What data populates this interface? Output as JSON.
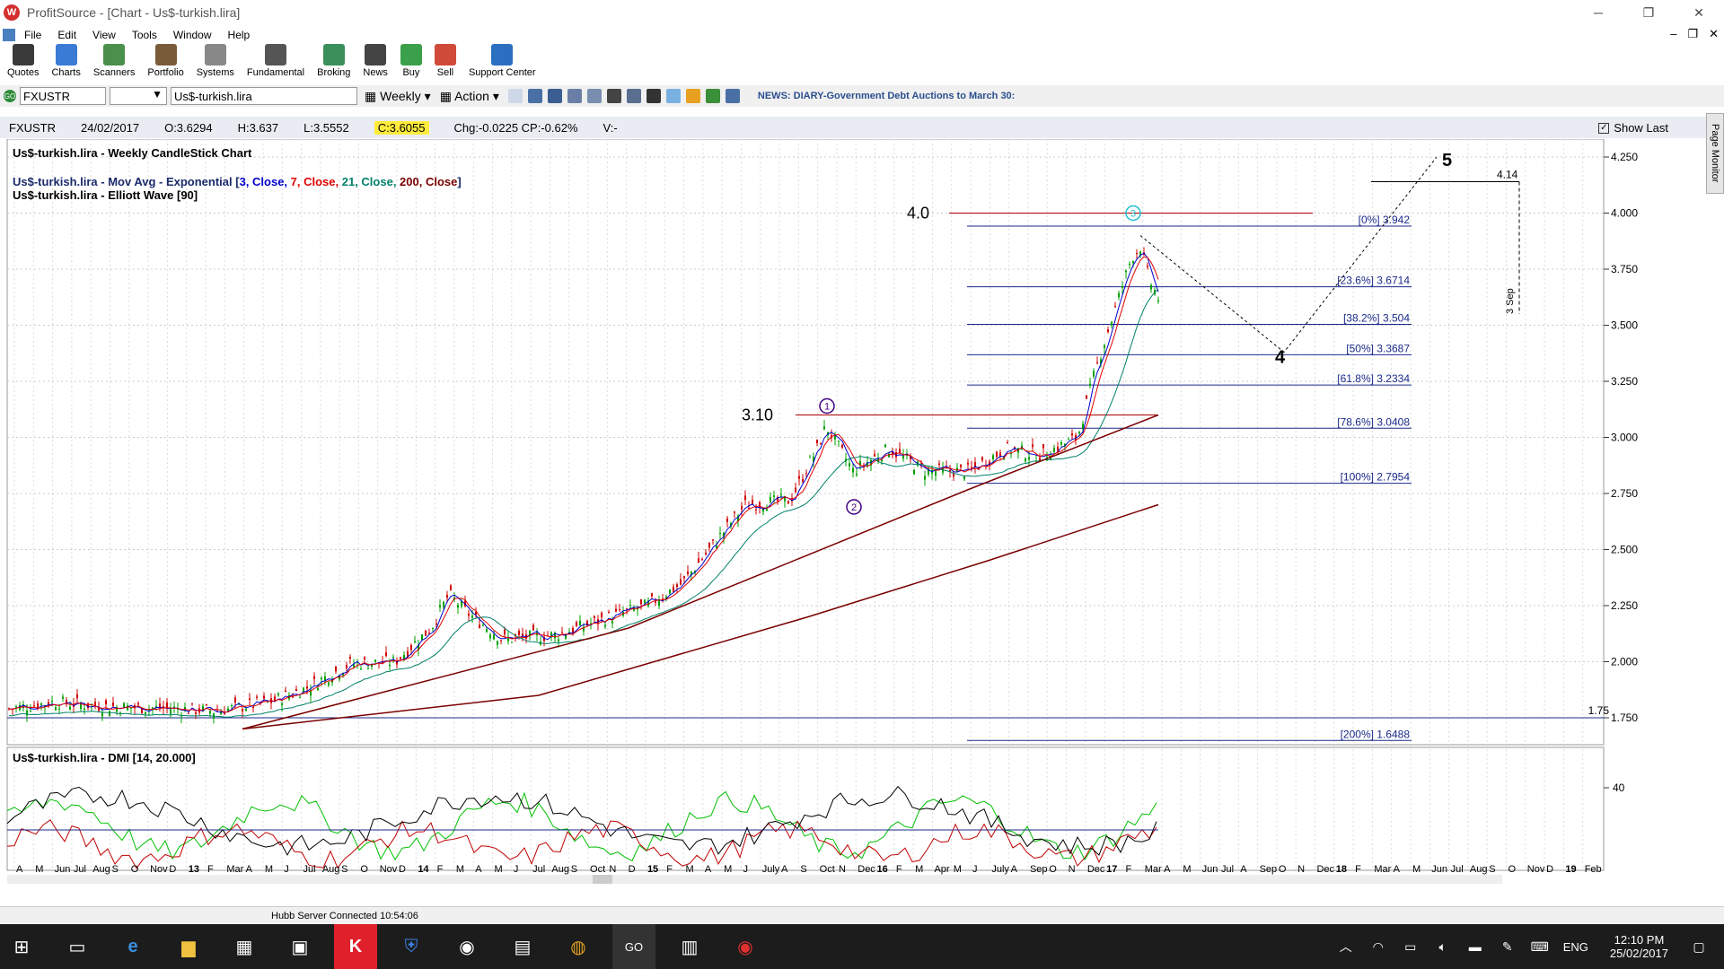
{
  "window": {
    "title": "ProfitSource - [Chart - Us$-turkish.lira]",
    "minimize": "─",
    "restore": "❐",
    "close": "✕"
  },
  "menu": [
    "File",
    "Edit",
    "View",
    "Tools",
    "Window",
    "Help"
  ],
  "toolbar": [
    {
      "label": "Quotes",
      "icon": "quotes-icon",
      "color": "#3a3a3a"
    },
    {
      "label": "Charts",
      "icon": "charts-icon",
      "color": "#3a7bd5"
    },
    {
      "label": "Scanners",
      "icon": "scanners-icon",
      "color": "#4a8f4a"
    },
    {
      "label": "Portfolio",
      "icon": "portfolio-icon",
      "color": "#7a5c3a"
    },
    {
      "label": "Systems",
      "icon": "systems-icon",
      "color": "#888888"
    },
    {
      "label": "Fundamental",
      "icon": "fundamental-icon",
      "color": "#555555"
    },
    {
      "label": "Broking",
      "icon": "broking-icon",
      "color": "#3a8f5a"
    },
    {
      "label": "News",
      "icon": "news-icon",
      "color": "#444444"
    },
    {
      "label": "Buy",
      "icon": "buy-icon",
      "color": "#3aa04a"
    },
    {
      "label": "Sell",
      "icon": "sell-icon",
      "color": "#d04a3a"
    },
    {
      "label": "Support Center",
      "icon": "help-icon",
      "color": "#2a6fc0"
    }
  ],
  "search": {
    "symbol": "FXUSTR",
    "name": "Us$-turkish.lira",
    "period": "Weekly",
    "action": "Action",
    "news": "NEWS: DIARY-Government Debt Auctions to March 30:"
  },
  "quote": {
    "symbol": "FXUSTR",
    "date": "24/02/2017",
    "open": "O:3.6294",
    "high": "H:3.637",
    "low": "L:3.5552",
    "close": "C:3.6055",
    "change": "Chg:-0.0225 CP:-0.62%",
    "volume": "V:-",
    "show_last": "Show Last",
    "page_monitor": "Page Monitor"
  },
  "chart_labels": {
    "title": "Us$-turkish.lira - Weekly CandleStick Chart",
    "ma_prefix": "Us$-turkish.lira - Mov Avg - Exponential [",
    "ma_parts": [
      "3, Close, ",
      "7, Close, ",
      "21, Close, ",
      "200, Close"
    ],
    "ma_suffix": "]",
    "elliott": "Us$-turkish.lira - Elliott Wave [90]",
    "dmi": "Us$-turkish.lira - DMI [14, 20.000]"
  },
  "chart_data": {
    "type": "candlestick",
    "y_ticks": [
      "4.250",
      "4.000",
      "3.750",
      "3.500",
      "3.250",
      "3.000",
      "2.750",
      "2.500",
      "2.250",
      "2.000",
      "1.750"
    ],
    "ylim": [
      1.63,
      4.33
    ],
    "fib_levels": [
      {
        "label": "[0%] 3.942",
        "value": 3.942
      },
      {
        "label": "[23.6%] 3.6714",
        "value": 3.6714
      },
      {
        "label": "[38.2%] 3.504",
        "value": 3.504
      },
      {
        "label": "[50%] 3.3687",
        "value": 3.3687
      },
      {
        "label": "[61.8%] 3.2334",
        "value": 3.2334
      },
      {
        "label": "[78.6%] 3.0408",
        "value": 3.0408
      },
      {
        "label": "[100%] 2.7954",
        "value": 2.7954
      },
      {
        "label": "[200%] 1.6488",
        "value": 1.6488
      }
    ],
    "annotations": [
      {
        "text": "4.0",
        "value": 4.0
      },
      {
        "text": "3.10",
        "value": 3.1
      },
      {
        "text": "4.14",
        "value": 4.14
      },
      {
        "text": "1.75",
        "value": 1.75
      },
      {
        "text": "5"
      },
      {
        "text": "4"
      },
      {
        "text": "3 Sep"
      }
    ],
    "wave_labels": [
      "1",
      "2",
      "3"
    ],
    "dmi_ticks": [
      "40"
    ],
    "x_labels": [
      "A",
      "M",
      "Jun",
      "Jul",
      "Aug",
      "S",
      "O",
      "Nov",
      "D",
      "13",
      "F",
      "Mar",
      "A",
      "M",
      "J",
      "Jul",
      "Aug",
      "S",
      "O",
      "Nov",
      "D",
      "14",
      "F",
      "M",
      "A",
      "M",
      "J",
      "Jul",
      "Aug",
      "S",
      "Oct",
      "N",
      "D",
      "15",
      "F",
      "M",
      "A",
      "M",
      "J",
      "July",
      "A",
      "S",
      "Oct",
      "N",
      "Dec",
      "16",
      "F",
      "M",
      "Apr",
      "M",
      "J",
      "July",
      "A",
      "Sep",
      "O",
      "N",
      "Dec",
      "17",
      "F",
      "Mar",
      "A",
      "M",
      "Jun",
      "Jul",
      "A",
      "Sep",
      "O",
      "N",
      "Dec",
      "18",
      "F",
      "Mar",
      "A",
      "M",
      "Jun",
      "Jul",
      "Aug",
      "S",
      "O",
      "Nov",
      "D",
      "19",
      "Feb"
    ],
    "colors": {
      "ma3": "#0000cc",
      "ma7": "#e00000",
      "ma21": "#00806a",
      "ma200": "#7a0000",
      "up": "#00a000",
      "down": "#d00000"
    }
  },
  "status": {
    "text": "Hubb Server Connected 10:54:06"
  },
  "taskbar": {
    "lang": "ENG",
    "time": "12:10 PM",
    "date": "25/02/2017"
  }
}
